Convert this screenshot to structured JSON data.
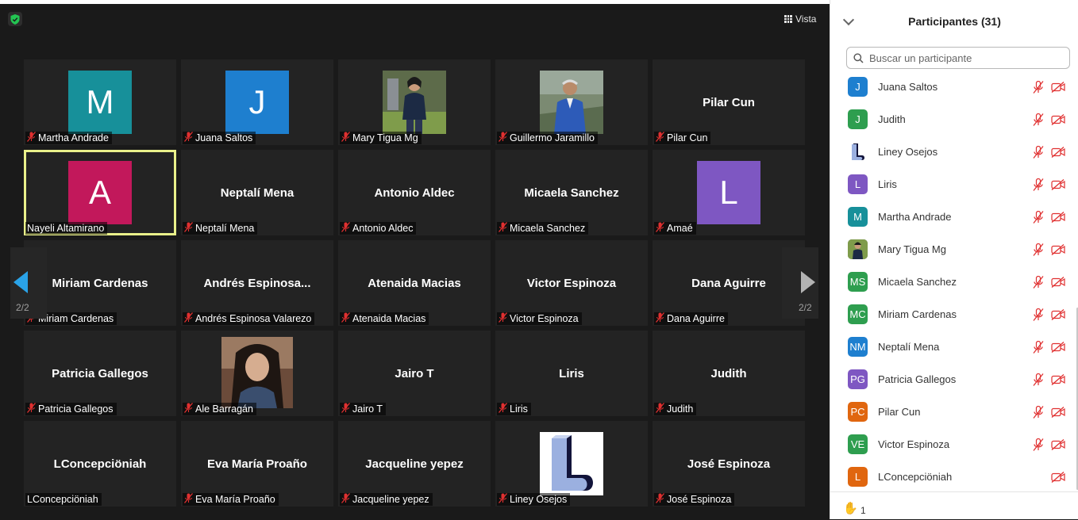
{
  "colors": {
    "accent": "#2aa3e8",
    "active_border": "#e9f08a",
    "muted_red": "#e03030"
  },
  "meeting": {
    "view_label": "Vista",
    "page_left": "2/2",
    "page_right": "2/2",
    "tiles": [
      {
        "big": "",
        "label": "Martha Andrade",
        "muted": true,
        "avatar": "M",
        "avatar_color": "#17909a"
      },
      {
        "big": "",
        "label": "Juana Saltos",
        "muted": true,
        "avatar": "J",
        "avatar_color": "#1e7fcf"
      },
      {
        "big": "",
        "label": "Mary Tigua Mg",
        "muted": true,
        "photo": "woman-photo"
      },
      {
        "big": "",
        "label": "Guillermo Jaramillo",
        "muted": true,
        "photo": "man-photo"
      },
      {
        "big": "Pilar Cun",
        "label": "Pilar Cun",
        "muted": true
      },
      {
        "big": "",
        "label": "Nayeli Altamirano",
        "muted": false,
        "avatar": "A",
        "avatar_color": "#c2185b",
        "active": true
      },
      {
        "big": "Neptalí Mena",
        "label": "Neptalí Mena",
        "muted": true
      },
      {
        "big": "Antonio Aldec",
        "label": "Antonio Aldec",
        "muted": true
      },
      {
        "big": "Micaela Sanchez",
        "label": "Micaela Sanchez",
        "muted": true
      },
      {
        "big": "",
        "label": "Amaé",
        "muted": true,
        "avatar": "L",
        "avatar_color": "#7e57c2"
      },
      {
        "big": "Miriam Cardenas",
        "label": "Miriam Cardenas",
        "muted": true
      },
      {
        "big": "Andrés  Espinosa...",
        "label": "Andrés Espinosa Valarezo",
        "muted": true
      },
      {
        "big": "Atenaida Macias",
        "label": "Atenaida Macias",
        "muted": true
      },
      {
        "big": "Victor Espinoza",
        "label": "Victor Espinoza",
        "muted": true
      },
      {
        "big": "Dana Aguirre",
        "label": "Dana Aguirre",
        "muted": true
      },
      {
        "big": "Patricia Gallegos",
        "label": "Patricia Gallegos",
        "muted": true
      },
      {
        "big": "",
        "label": "Ale Barragán",
        "muted": true,
        "photo": "woman-selfie-photo"
      },
      {
        "big": "Jairo T",
        "label": "Jairo T",
        "muted": true
      },
      {
        "big": "Liris",
        "label": "Liris",
        "muted": true
      },
      {
        "big": "Judith",
        "label": "Judith",
        "muted": true
      },
      {
        "big": "LConcepciöniah",
        "label": "LConcepciöniah",
        "muted": false
      },
      {
        "big": "Eva María Proaño",
        "label": "Eva María Proaño",
        "muted": true
      },
      {
        "big": "Jacqueline yepez",
        "label": "Jacqueline yepez",
        "muted": true
      },
      {
        "big": "",
        "label": "Liney Osejos",
        "muted": true,
        "photo": "letter-l-logo"
      },
      {
        "big": "José Espinoza",
        "label": "José Espinoza",
        "muted": true
      }
    ]
  },
  "panel": {
    "title": "Participantes (31)",
    "search_placeholder": "Buscar un participante",
    "participants": [
      {
        "name": "Juana Saltos",
        "initials": "J",
        "color": "#1e7fcf",
        "mic_muted": true
      },
      {
        "name": "Judith",
        "initials": "J",
        "color": "#2e9e4f",
        "mic_muted": true
      },
      {
        "name": "Liney Osejos",
        "initials": "",
        "color": "#ffffff",
        "logo": true,
        "mic_muted": true
      },
      {
        "name": "Liris",
        "initials": "L",
        "color": "#7e57c2",
        "mic_muted": true
      },
      {
        "name": "Martha Andrade",
        "initials": "M",
        "color": "#17909a",
        "mic_muted": true
      },
      {
        "name": "Mary Tigua Mg",
        "initials": "",
        "color": "#556b4a",
        "photo": true,
        "mic_muted": true
      },
      {
        "name": "Micaela Sanchez",
        "initials": "MS",
        "color": "#2e9e4f",
        "mic_muted": true
      },
      {
        "name": "Miriam Cardenas",
        "initials": "MC",
        "color": "#2e9e4f",
        "mic_muted": true
      },
      {
        "name": "Neptalí Mena",
        "initials": "NM",
        "color": "#1e7fcf",
        "mic_muted": true
      },
      {
        "name": "Patricia Gallegos",
        "initials": "PG",
        "color": "#7e57c2",
        "mic_muted": true
      },
      {
        "name": "Pilar Cun",
        "initials": "PC",
        "color": "#e0660f",
        "mic_muted": true
      },
      {
        "name": "Victor Espinoza",
        "initials": "VE",
        "color": "#2e9e4f",
        "mic_muted": true
      },
      {
        "name": "LConcepciöniah",
        "initials": "L",
        "color": "#e0660f",
        "mic_muted": false
      }
    ],
    "raised_hands": "1"
  }
}
